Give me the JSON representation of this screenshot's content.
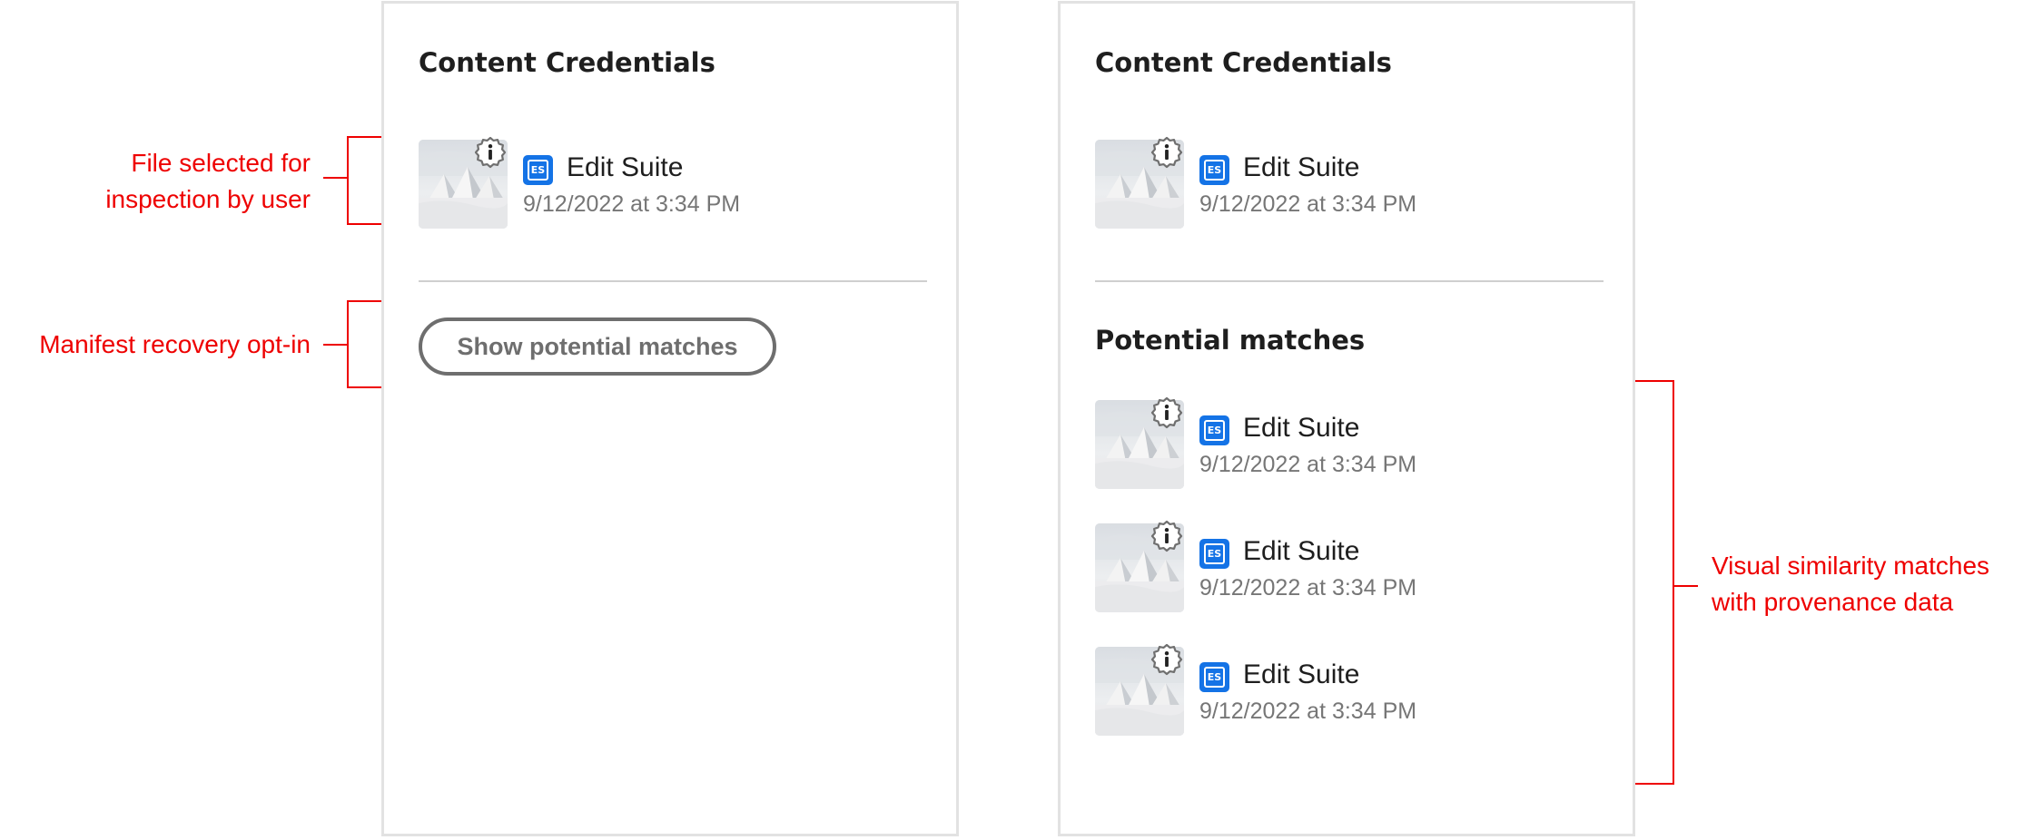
{
  "left_panel": {
    "title": "Content Credentials",
    "selected_file": {
      "app_icon": "ES",
      "app_name": "Edit Suite",
      "timestamp": "9/12/2022 at 3:34 PM"
    },
    "show_matches_button": "Show potential matches"
  },
  "right_panel": {
    "title": "Content Credentials",
    "selected_file": {
      "app_icon": "ES",
      "app_name": "Edit Suite",
      "timestamp": "9/12/2022 at 3:34 PM"
    },
    "matches_heading": "Potential matches",
    "matches": [
      {
        "app_icon": "ES",
        "app_name": "Edit Suite",
        "timestamp": "9/12/2022 at 3:34 PM"
      },
      {
        "app_icon": "ES",
        "app_name": "Edit Suite",
        "timestamp": "9/12/2022 at 3:34 PM"
      },
      {
        "app_icon": "ES",
        "app_name": "Edit Suite",
        "timestamp": "9/12/2022 at 3:34 PM"
      }
    ]
  },
  "annotations": {
    "file_selected": [
      "File selected for",
      "inspection by user"
    ],
    "manifest_recovery": "Manifest recovery opt-in",
    "visual_similarity": [
      "Visual similarity matches",
      "with provenance data"
    ]
  },
  "colors": {
    "annotation": "#ee0000",
    "app_icon": "#1473e6",
    "panel_border": "#e2e2e2"
  },
  "icons": {
    "thumbnail": "pyramid-thumbnail",
    "badge": "info-badge-icon",
    "app": "edit-suite-app-icon"
  }
}
